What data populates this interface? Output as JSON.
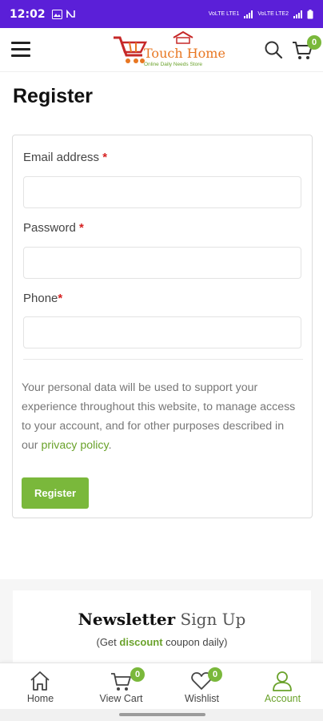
{
  "status_bar": {
    "time": "12:02",
    "network_left": "VoLTE LTE1",
    "network_right": "VoLTE LTE2"
  },
  "header": {
    "logo": {
      "brand": "Touch Home",
      "tagline": "Online Daily Needs Store"
    },
    "cart_count": "0"
  },
  "page": {
    "title": "Register"
  },
  "form": {
    "email_label": "Email address",
    "password_label": "Password",
    "phone_label": "Phone",
    "required_mark": "*",
    "email_value": "",
    "password_value": "",
    "phone_value": "",
    "privacy_text": "Your personal data will be used to support your experience throughout this website, to manage access to your account, and for other purposes described in our ",
    "privacy_link": "privacy policy",
    "privacy_end": ".",
    "submit_label": "Register"
  },
  "newsletter": {
    "title_bold": "Newsletter",
    "title_light": "Sign Up",
    "sub_before": "(Get ",
    "sub_highlight": "discount",
    "sub_after": " coupon daily)"
  },
  "bottom_nav": {
    "items": [
      {
        "label": "Home"
      },
      {
        "label": "View Cart",
        "badge": "0"
      },
      {
        "label": "Wishlist",
        "badge": "0"
      },
      {
        "label": "Account"
      }
    ]
  },
  "colors": {
    "status_bar": "#5b1fd8",
    "accent_green": "#7ab83b",
    "logo_orange": "#e87722",
    "required_red": "#d62222"
  }
}
